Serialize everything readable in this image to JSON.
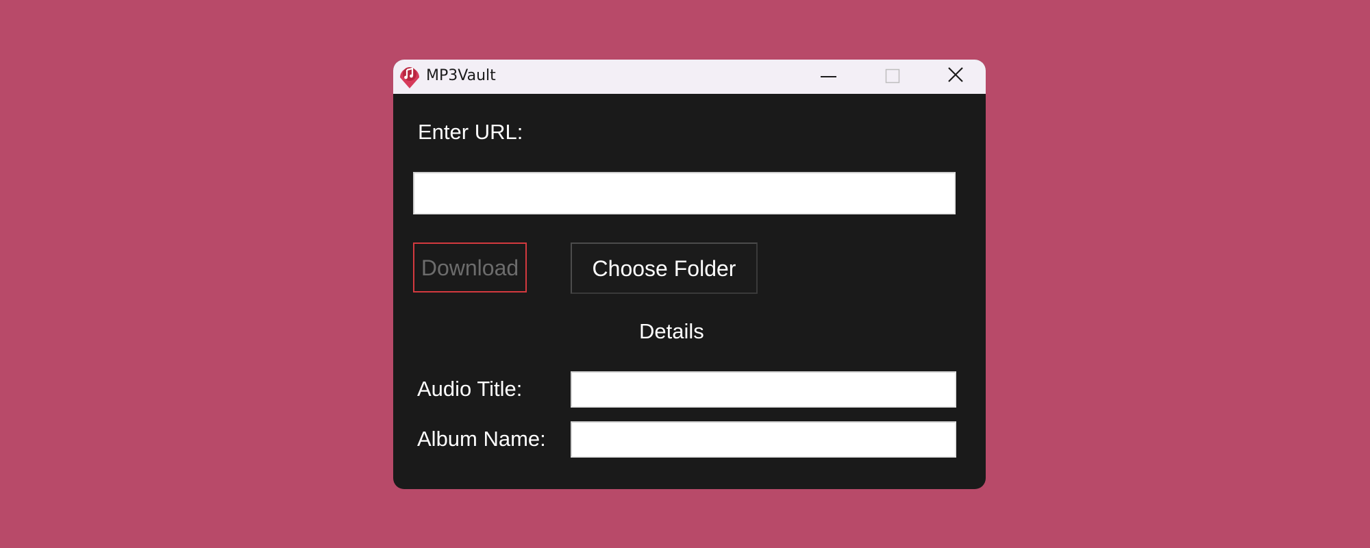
{
  "window": {
    "title": "MP3Vault",
    "controls": [
      "minimize-icon",
      "maximize-icon",
      "close-icon"
    ],
    "app_icon": "music-note-icon",
    "accent_color": "#d43a3f"
  },
  "form": {
    "url_label": "Enter URL:",
    "url_value": "",
    "download_label": "Download",
    "choose_folder_label": "Choose Folder",
    "details_heading": "Details",
    "audio_title_label": "Audio Title:",
    "audio_title_value": "",
    "album_name_label": "Album Name:",
    "album_name_value": ""
  }
}
